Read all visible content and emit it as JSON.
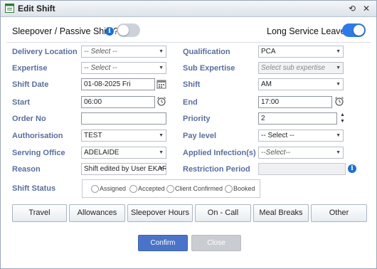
{
  "window": {
    "title": "Edit Shift",
    "title_icon": "form-icon",
    "restore_icon": "refresh-icon",
    "close_icon": "close-icon"
  },
  "top": {
    "sleepover_label": "Sleepover / Passive Shift ?",
    "sleepover_on": false,
    "long_service_label": "Long Service Leave ?",
    "long_service_on": true,
    "toggle_on_color": "#2e7be6",
    "toggle_off_color": "#cdd2d8"
  },
  "form": {
    "delivery_location": {
      "label": "Delivery Location",
      "value": "-- Select --"
    },
    "qualification": {
      "label": "Qualification",
      "value": "PCA"
    },
    "expertise": {
      "label": "Expertise",
      "value": "-- Select --"
    },
    "sub_expertise": {
      "label": "Sub Expertise",
      "value": "Select sub expertise"
    },
    "shift_date": {
      "label": "Shift Date",
      "value": "01-08-2025 Fri"
    },
    "shift": {
      "label": "Shift",
      "value": "AM"
    },
    "start": {
      "label": "Start",
      "value": "06:00"
    },
    "end": {
      "label": "End",
      "value": "17:00"
    },
    "order_no": {
      "label": "Order No",
      "value": ""
    },
    "priority": {
      "label": "Priority",
      "value": "2"
    },
    "authorisation": {
      "label": "Authorisation",
      "value": "TEST"
    },
    "pay_level": {
      "label": "Pay level",
      "value": "-- Select --"
    },
    "serving_office": {
      "label": "Serving Office",
      "value": "ADELAIDE"
    },
    "applied_infections": {
      "label": "Applied Infection(s)",
      "value": "--Select--"
    },
    "reason": {
      "label": "Reason",
      "value": "Shift edited by User EKARL"
    },
    "restriction_period": {
      "label": "Restriction Period",
      "value": ""
    },
    "shift_status": {
      "label": "Shift Status",
      "options": [
        "Assigned",
        "Accepted",
        "Client Confirmed",
        "Booked"
      ]
    }
  },
  "buttons": {
    "travel": "Travel",
    "allowances": "Allowances",
    "sleepover_hours": "Sleepover Hours",
    "on_call": "On - Call",
    "meal_breaks": "Meal Breaks",
    "other": "Other",
    "confirm": "Confirm",
    "close": "Close"
  },
  "colors": {
    "label": "#5a6f9e",
    "confirm_bg": "#4a74c9",
    "close_bg": "#c9ccd1"
  }
}
